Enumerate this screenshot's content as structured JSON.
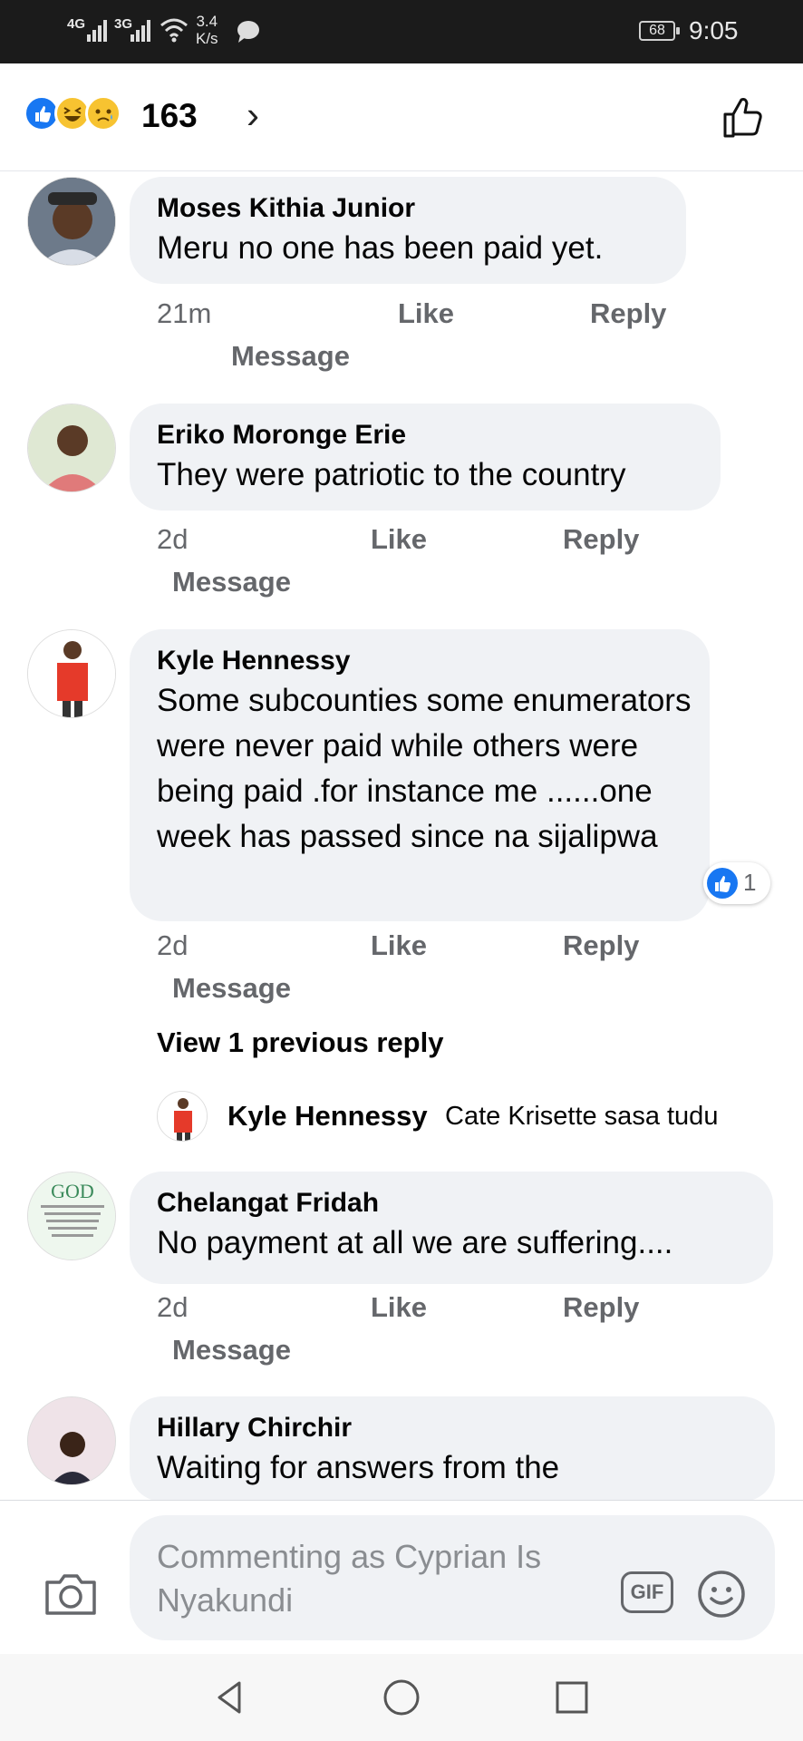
{
  "status_bar": {
    "signal_1": "4G",
    "signal_2": "3G",
    "speed": "3.4",
    "speed_unit": "K/s",
    "battery": "68",
    "time": "9:05"
  },
  "reactions": {
    "types": [
      "like-icon",
      "haha-icon",
      "sad-icon"
    ],
    "count": "163",
    "chevron": "›"
  },
  "comments": [
    {
      "name": "Moses Kithia Junior",
      "text": "Meru no one has been paid yet.",
      "age": "21m",
      "like": "Like",
      "reply": "Reply",
      "message": "Message"
    },
    {
      "name": "Eriko Moronge Erie",
      "text": "They were patriotic to the country",
      "age": "2d",
      "like": "Like",
      "reply": "Reply",
      "message": "Message"
    },
    {
      "name": "Kyle Hennessy",
      "text": "Some subcounties some enumerators were never paid while others were being paid .for instance me ......one week has passed since  na sijalipwa",
      "age": "2d",
      "like": "Like",
      "reply": "Reply",
      "message": "Message",
      "reaction_count": "1",
      "view_previous": "View 1 previous reply",
      "reply_preview": {
        "name": "Kyle Hennessy",
        "text": "Cate Krisette sasa tudu"
      }
    },
    {
      "name": "Chelangat Fridah",
      "text": "No payment at all we are suffering....",
      "age": "2d",
      "like": "Like",
      "reply": "Reply",
      "message": "Message",
      "avatar_text": "GOD"
    },
    {
      "name": "Hillary Chirchir",
      "text": "Waiting for answers from the"
    }
  ],
  "composer": {
    "placeholder": "Commenting as Cyprian Is Nyakundi",
    "gif_label": "GIF"
  },
  "colors": {
    "accent": "#1877f2",
    "bubble": "#f0f2f5",
    "meta": "#65676b"
  }
}
